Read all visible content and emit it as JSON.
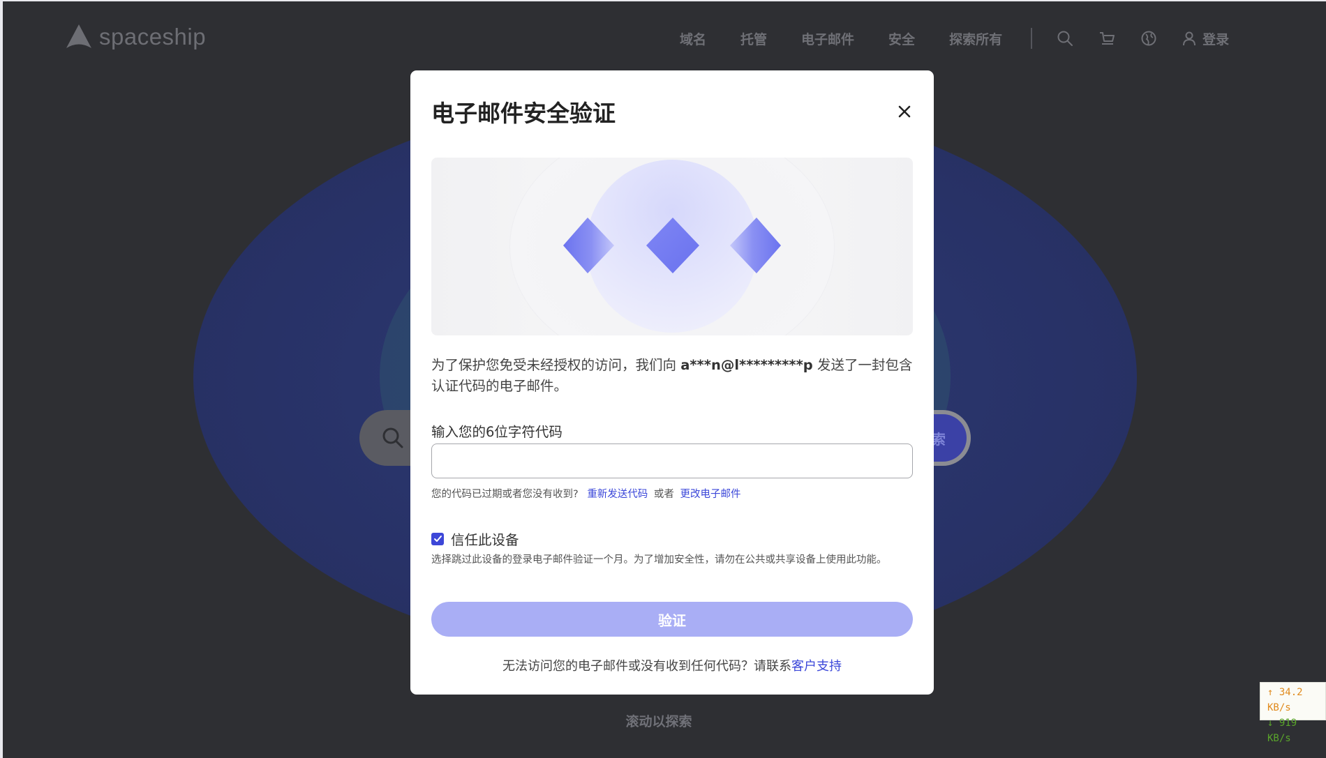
{
  "header": {
    "logo_text": "spaceship",
    "nav": [
      "域名",
      "托管",
      "电子邮件",
      "安全",
      "探索所有"
    ],
    "login_label": "登录"
  },
  "background": {
    "heading_left": "",
    "heading_right": "",
    "search_button": "索",
    "scroll_hint": "滚动以探索"
  },
  "modal": {
    "title": "电子邮件安全验证",
    "description_before": "为了保护您免受未经授权的访问，我们向 ",
    "masked_email": "a***n@l*********p",
    "description_after": " 发送了一封包含认证代码的电子邮件。",
    "code_label": "输入您的6位字符代码",
    "code_value": "",
    "resend_prefix": "您的代码已过期或者您没有收到?",
    "resend_link": "重新发送代码",
    "resend_or": "或者",
    "change_email_link": "更改电子邮件",
    "trust_label": "信任此设备",
    "trust_checked": true,
    "trust_note": "选择跳过此设备的登录电子邮件验证一个月。为了增加安全性，请勿在公共或共享设备上使用此功能。",
    "verify_label": "验证",
    "footer_prefix": "无法访问您的电子邮件或没有收到任何代码？请联系",
    "footer_link": "客户支持"
  },
  "network": {
    "upload": "↑ 34.2 KB/s",
    "download": "↓ 919 KB/s"
  },
  "colors": {
    "accent": "#3d47d8",
    "verify_disabled": "#a9aef5",
    "page_bg": "#2e2f33"
  }
}
